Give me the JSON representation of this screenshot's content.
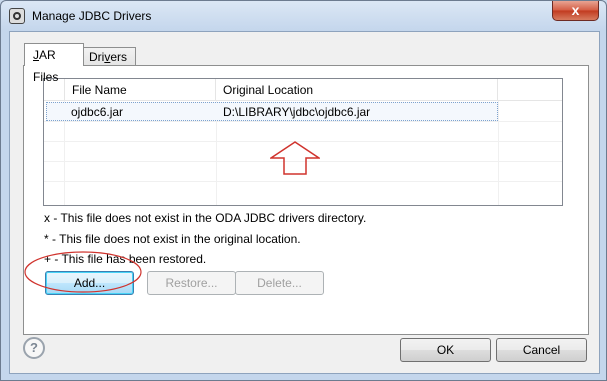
{
  "window": {
    "title": "Manage JDBC Drivers",
    "close_glyph": "x"
  },
  "tabs": [
    {
      "label_pre": "",
      "label_ul": "J",
      "label_post": "AR Files",
      "active": true
    },
    {
      "label_pre": "Dri",
      "label_ul": "v",
      "label_post": "ers",
      "active": false
    }
  ],
  "table": {
    "columns": [
      "File Name",
      "Original Location"
    ],
    "rows": [
      {
        "file_name": "ojdbc6.jar",
        "location": "D:\\LIBRARY\\jdbc\\ojdbc6.jar"
      }
    ]
  },
  "legend": [
    "x - This file does not exist in the ODA JDBC drivers directory.",
    "* - This file does not exist in the original location.",
    "+ - This file has been restored."
  ],
  "buttons": {
    "add": "Add...",
    "restore": "Restore...",
    "delete": "Delete...",
    "ok": "OK",
    "cancel": "Cancel"
  },
  "icons": {
    "help": "help-icon",
    "annotation_arrow": "up-arrow-annotation",
    "annotation_circle": "circle-annotation"
  },
  "colors": {
    "annotation": "#d0332d",
    "accent": "#3c7fb1"
  }
}
